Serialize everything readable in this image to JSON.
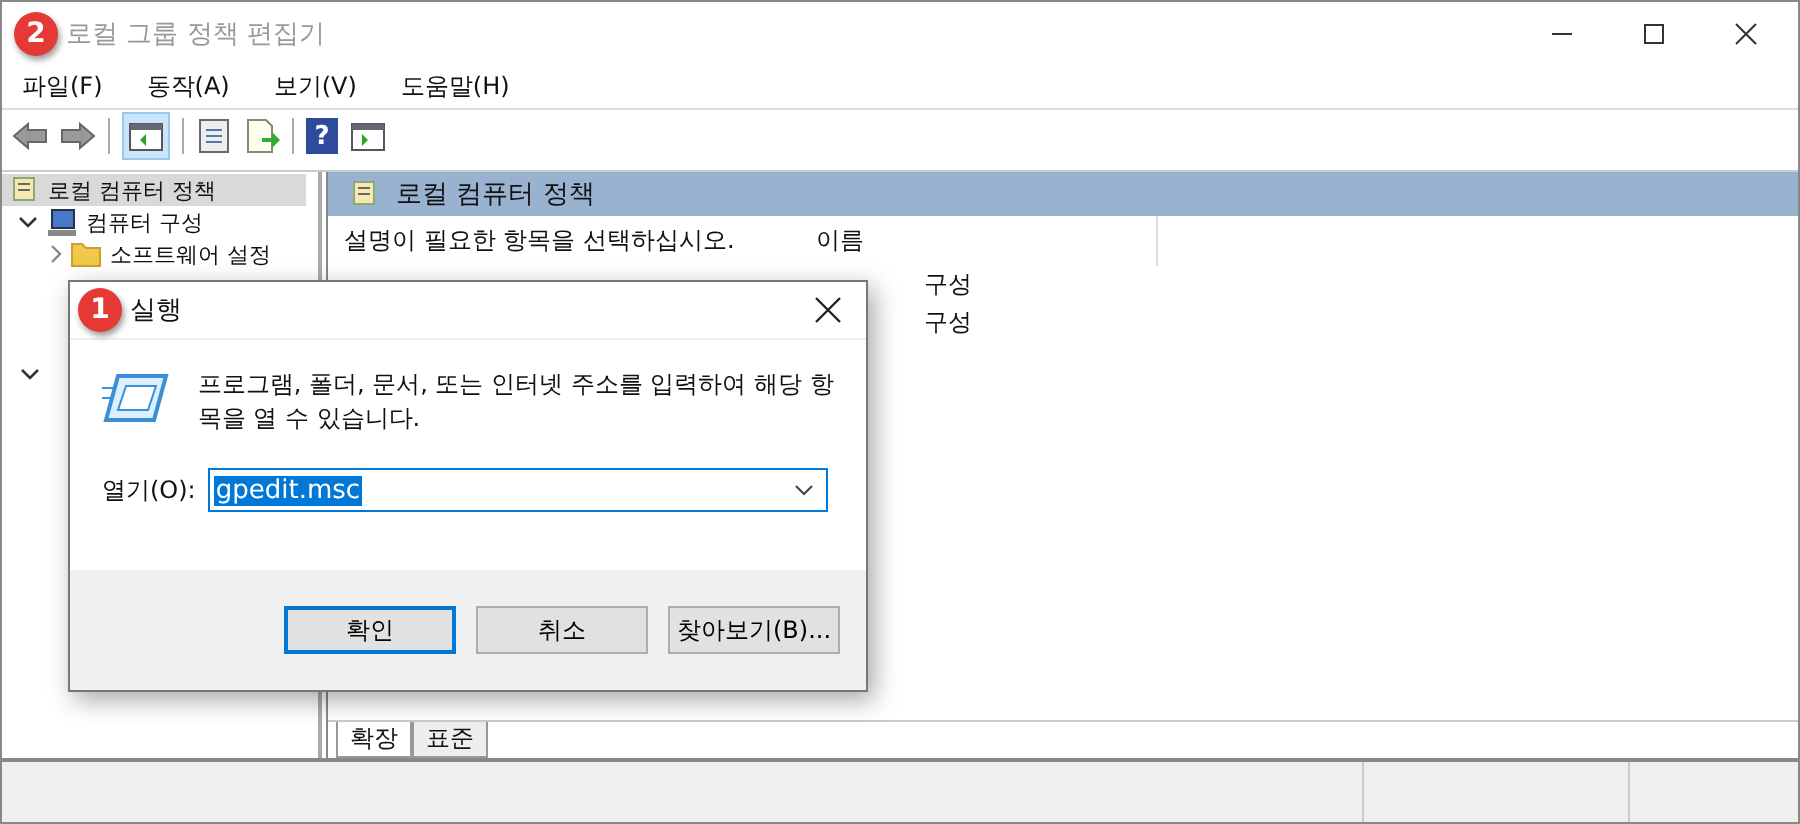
{
  "window": {
    "title": "로컬 그룹 정책 편집기",
    "badge": "2"
  },
  "menu": [
    "파일(F)",
    "동작(A)",
    "보기(V)",
    "도움말(H)"
  ],
  "toolbar": {
    "help": "?"
  },
  "tree": [
    {
      "label": "로컬 컴퓨터 정책",
      "selected": true,
      "children": [
        {
          "label": "컴퓨터 구성",
          "selected": false,
          "expanded": true,
          "children": [
            {
              "label": "소프트웨어 설정",
              "selected": false
            }
          ]
        }
      ]
    }
  ],
  "panel": {
    "title": "로컬 컴퓨터 정책",
    "description": "설명이 필요한 항목을 선택하십시오.",
    "column": "이름",
    "items": [
      "구성",
      "구성"
    ],
    "tabs": [
      {
        "label": "확장",
        "selected": true
      },
      {
        "label": "표준",
        "selected": false
      }
    ]
  },
  "dialog": {
    "title": "실행",
    "badge": "1",
    "message": "프로그램, 폴더, 문서, 또는 인터넷 주소를 입력하여 해당 항목을 열 수 있습니다.",
    "open_label": "열기(O):",
    "value": "gpedit.msc",
    "buttons": [
      {
        "label": "확인",
        "default": true
      },
      {
        "label": "취소",
        "default": false
      },
      {
        "label": "찾아보기(B)...",
        "default": false
      }
    ]
  }
}
